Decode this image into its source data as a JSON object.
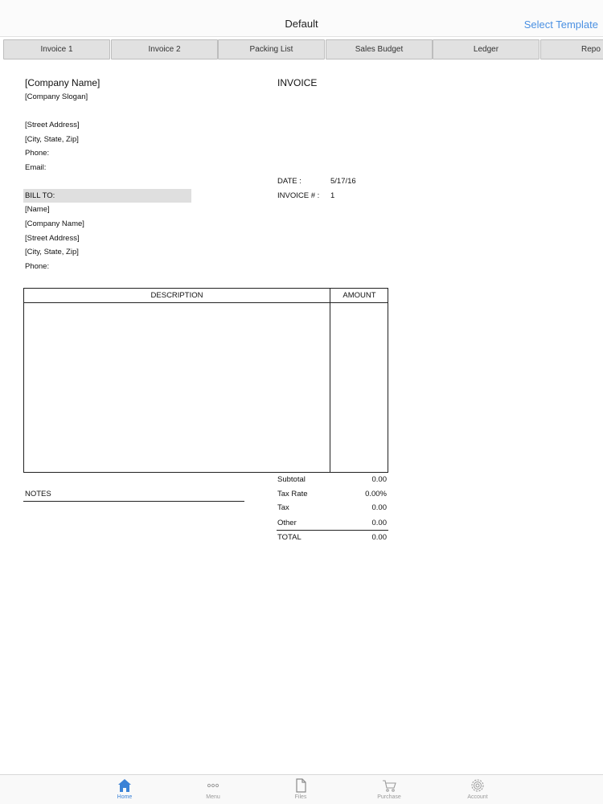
{
  "nav": {
    "title": "Default",
    "action": "Select Template"
  },
  "tabs": [
    "Invoice 1",
    "Invoice 2",
    "Packing List",
    "Sales Budget",
    "Ledger",
    "Repo"
  ],
  "invoice": {
    "company_name": "[Company Name]",
    "company_slogan": "[Company Slogan]",
    "street": "[Street Address]",
    "city": "[City, State,  Zip]",
    "phone": "Phone:",
    "email": "Email:",
    "title": "INVOICE",
    "date_label": "DATE :",
    "date_value": "5/17/16",
    "number_label": "INVOICE # :",
    "number_value": "1",
    "bill_to": {
      "heading": "BILL TO:",
      "name": "[Name]",
      "company": "[Company Name]",
      "street": "[Street Address]",
      "city": "[City, State,  Zip]",
      "phone": "Phone:"
    },
    "table": {
      "col_description": "DESCRIPTION",
      "col_amount": "AMOUNT"
    },
    "notes_label": "NOTES",
    "totals": [
      {
        "label": "Subtotal",
        "value": "0.00"
      },
      {
        "label": "Tax Rate",
        "value": "0.00%"
      },
      {
        "label": "Tax",
        "value": "0.00"
      },
      {
        "label": "Other",
        "value": "0.00"
      },
      {
        "label": "TOTAL",
        "value": "0.00"
      }
    ]
  },
  "tabbar": [
    {
      "label": "Home",
      "icon": "home-icon",
      "active": true
    },
    {
      "label": "Menu",
      "icon": "more-icon",
      "active": false
    },
    {
      "label": "Files",
      "icon": "file-icon",
      "active": false
    },
    {
      "label": "Purchase",
      "icon": "cart-icon",
      "active": false
    },
    {
      "label": "Account",
      "icon": "gear-icon",
      "active": false
    }
  ],
  "colors": {
    "accent": "#4a90e2",
    "active_tab": "#3b82d6",
    "tab_bg": "#e1e1e1"
  }
}
